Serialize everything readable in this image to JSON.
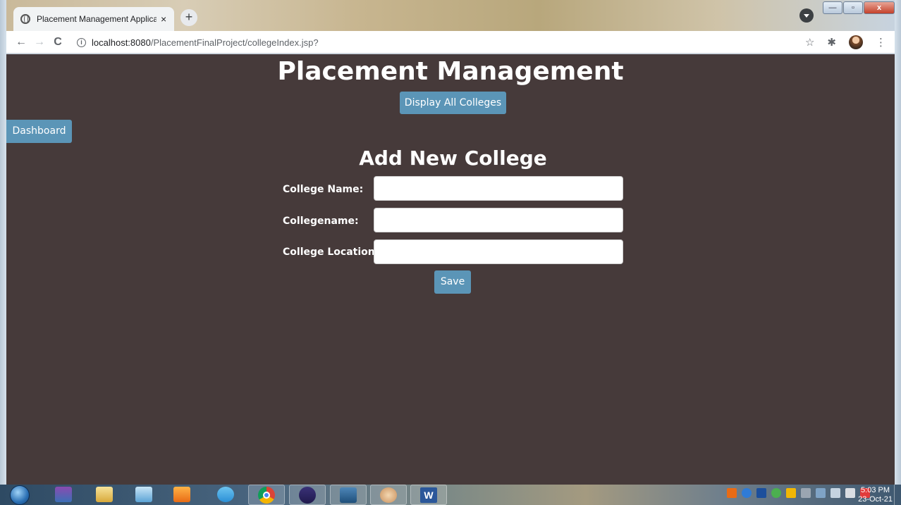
{
  "browser": {
    "tab_title": "Placement Management Applicat",
    "tab_close": "×",
    "new_tab": "+",
    "url_host": "localhost:8080",
    "url_path": "/PlacementFinalProject/collegeIndex.jsp?",
    "back": "←",
    "forward": "→",
    "reload": "C",
    "star": "☆",
    "extensions": "✱",
    "menu": "⋮",
    "minimize": "—",
    "maximize": "▫",
    "close": "x"
  },
  "page": {
    "title": "Placement Management",
    "display_all_button": "Display All Colleges",
    "dashboard_button": "Dashboard",
    "form_title": "Add New College",
    "fields": [
      {
        "label": "College Name:",
        "value": ""
      },
      {
        "label": "Collegename:",
        "value": ""
      },
      {
        "label": "College Location:",
        "value": ""
      }
    ],
    "save_button": "Save"
  },
  "colors": {
    "page_background": "#463a3a",
    "button": "#5b95b7",
    "text": "#ffffff"
  },
  "taskbar": {
    "clock_time": "5:03 PM",
    "clock_date": "23-Oct-21",
    "apps": [
      "winrar-icon",
      "file-manager-icon",
      "notepad-icon",
      "sublime-icon",
      "telegram-icon",
      "chrome-icon",
      "eclipse-icon",
      "mysql-icon",
      "paint-icon",
      "word-icon"
    ]
  }
}
